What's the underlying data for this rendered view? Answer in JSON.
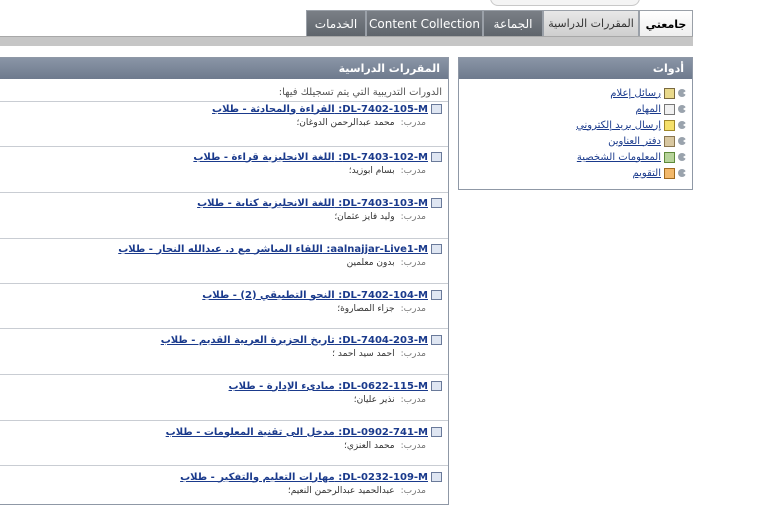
{
  "tabs": [
    "جامعتي",
    "المقررات الدراسية",
    "الجماعة",
    "Content Collection",
    "الخدمات"
  ],
  "tools": {
    "title": "أدوات",
    "items": [
      {
        "label": "رسائل إعلام",
        "icon": "announcement-icon"
      },
      {
        "label": "المهام",
        "icon": "tasks-icon"
      },
      {
        "label": "إرسال بريد إلكتروني",
        "icon": "email-icon"
      },
      {
        "label": "دفتر العناوين",
        "icon": "address-book-icon"
      },
      {
        "label": "المعلومات الشخصية",
        "icon": "personal-info-icon"
      },
      {
        "label": "التقويم",
        "icon": "calendar-icon"
      }
    ]
  },
  "courses": {
    "title": "المقررات الدراسية",
    "intro": "الدورات التدريبية التي يتم تسجيلك فيها:",
    "instructor_label": "مدرب:",
    "items": [
      {
        "code": "DL-7402-105-M",
        "name": "القراءة والمحادثة - طلاب",
        "instructor": "محمد عبدالرحمن الدوغان؛"
      },
      {
        "code": "DL-7403-102-M",
        "name": "اللغة الانجليزية قراءة - طلاب",
        "instructor": "بسام ابوزيد؛"
      },
      {
        "code": "DL-7403-103-M",
        "name": "اللغة الانجليزية كتابة - طلاب",
        "instructor": "وليد فايز عثمان؛"
      },
      {
        "code": "aalnajjar-Live1-M",
        "name": "اللقاء المباشر مع د. عبدالله النجار - طلاب",
        "instructor": "بدون معلمين"
      },
      {
        "code": "DL-7402-104-M",
        "name": "النحو التطبيقي (2) - طلاب",
        "instructor": "جزاء المصاروة؛"
      },
      {
        "code": "DL-7404-203-M",
        "name": "تاريخ الجزيرة العربية القديم - طلاب",
        "instructor": "احمد سيد احمد ؛"
      },
      {
        "code": "DL-0622-115-M",
        "name": "مبادىء الإدارة - طلاب",
        "instructor": "نذير عليان؛"
      },
      {
        "code": "DL-0902-741-M",
        "name": "مدخل الى تقنية المعلومات - طلاب",
        "instructor": "محمد العنزي؛"
      },
      {
        "code": "DL-0232-109-M",
        "name": "مهارات التعليم والتفكير - طلاب",
        "instructor": "عبدالحميد عبدالرحمن النعيم؛"
      }
    ]
  }
}
